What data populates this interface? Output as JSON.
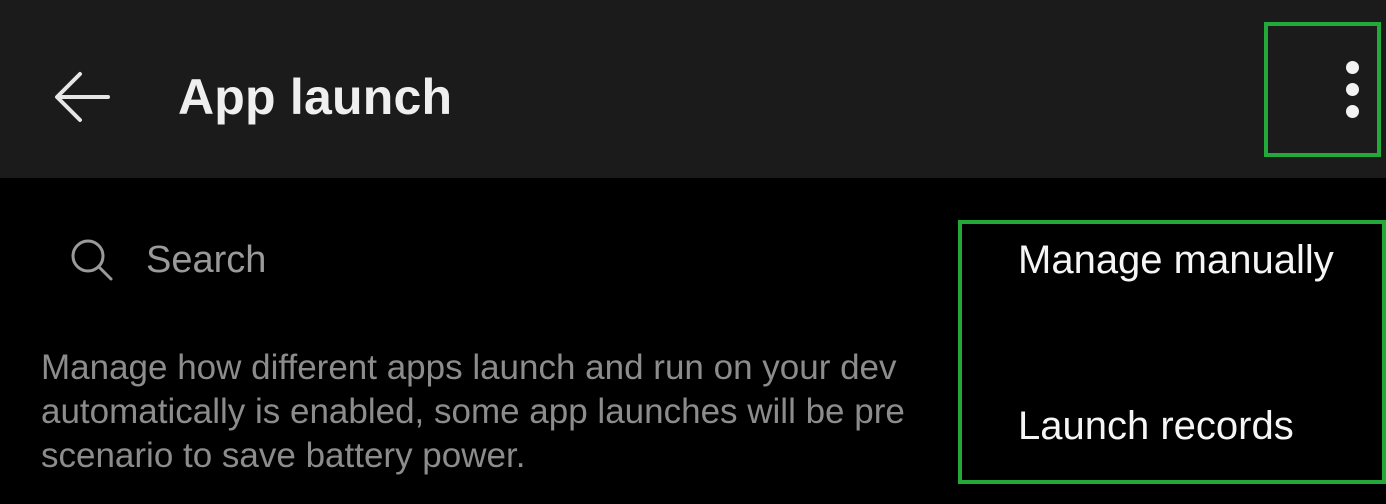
{
  "header": {
    "title": "App launch"
  },
  "search": {
    "placeholder": "Search"
  },
  "description": {
    "lines": [
      "Manage how different apps launch and run on your dev",
      "automatically is enabled, some app launches will be pre",
      "scenario to save battery power."
    ]
  },
  "menu": {
    "items": [
      {
        "label": "Manage manually"
      },
      {
        "label": "Launch records"
      }
    ]
  },
  "icons": {
    "back": "arrow-left-icon",
    "more": "more-vertical-icon",
    "search": "search-icon"
  },
  "colors": {
    "appbar_background": "#1b1b1b",
    "page_background": "#000000",
    "highlight": "#22a93a",
    "title_text": "#efefef",
    "secondary_text": "#8c8c8c"
  }
}
